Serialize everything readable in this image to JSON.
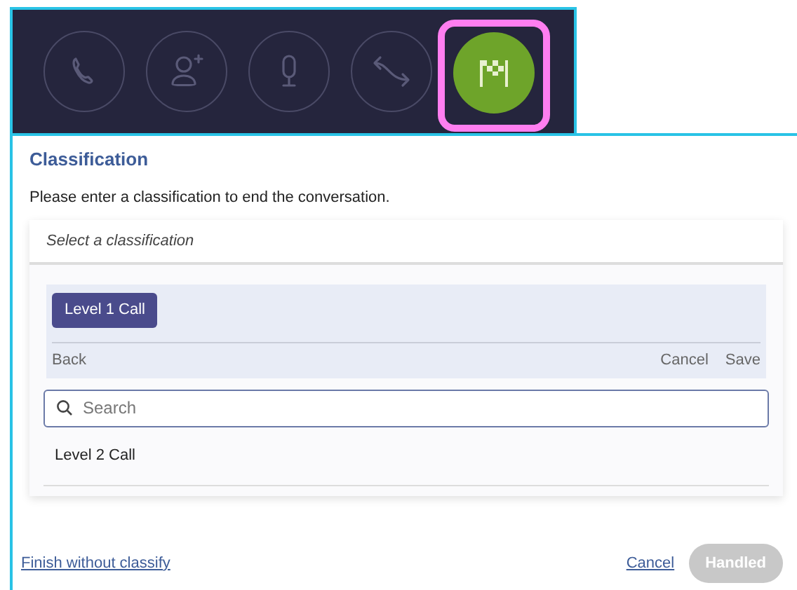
{
  "toolbar": {
    "buttons": [
      {
        "kind": "phone",
        "selected": false
      },
      {
        "kind": "add-person",
        "selected": false
      },
      {
        "kind": "microphone",
        "selected": false
      },
      {
        "kind": "transfer",
        "selected": false
      },
      {
        "kind": "finish",
        "selected": true
      }
    ]
  },
  "panel": {
    "title": "Classification",
    "description": "Please enter a classification to end the conversation.",
    "selector": {
      "header": "Select a classification",
      "chip": "Level 1 Call",
      "back": "Back",
      "cancel": "Cancel",
      "save": "Save",
      "search": {
        "placeholder": "Search"
      },
      "options": [
        "Level 2 Call"
      ]
    }
  },
  "footer": {
    "link": "Finish without classify",
    "cancel": "Cancel",
    "handled": {
      "label": "Handled",
      "disabled": true
    }
  }
}
